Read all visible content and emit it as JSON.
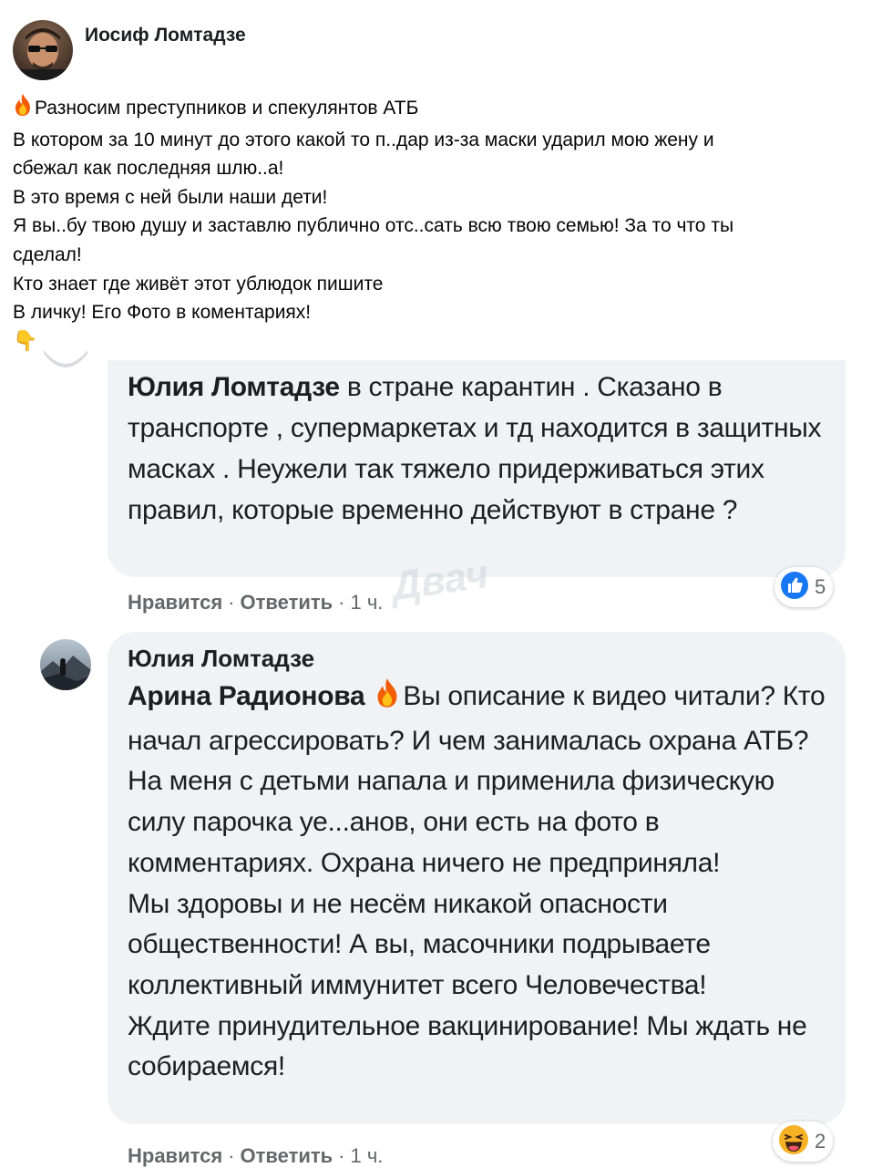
{
  "post": {
    "author": "Иосиф Ломтадзе",
    "lines": [
      "Разносим преступников и спекулянтов АТБ",
      "В котором за 10 минут до этого какой то п..дар из-за маски ударил мою жену и",
      "сбежал как последняя шлю..а!",
      "В это время с ней были наши дети!",
      "Я вы..бу твою душу и заставлю публично отс..сать всю твою семью! За то что ты",
      "сделал!",
      "Кто знает где живёт этот ублюдок пишите",
      "В личку! Его Фото в коментариях!"
    ],
    "leading_emoji": "fire-icon",
    "trailing_emoji": "👇"
  },
  "comments": [
    {
      "mention": "Юлия Ломтадзе",
      "text": " в стране карантин . Сказано в транспорте , супермаркетах и тд находится в защитных масках . Неужели так тяжело придерживаться этих правил, которые временно действуют в стране ?",
      "reaction_icon": "like-icon",
      "reaction_count": "5",
      "like_label": "Нравится",
      "reply_label": "Ответить",
      "time": "1 ч."
    },
    {
      "author": "Юлия Ломтадзе",
      "mention": "Арина Радионова",
      "text": "Вы описание к видео читали? Кто начал агрессировать? И чем занималась охрана АТБ? На меня с детьми напала и применила физическую силу парочка уе...анов, они есть на фото в комментариях. Охрана ничего не предприняла!",
      "text_2": "Мы здоровы и не несём никакой опасности общественности! А вы, масочники подрываете коллективный иммунитет всего Человечества!",
      "text_3": "Ждите принудительное вакцинирование! Мы ждать не собираемся!",
      "reaction_icon": "laughing-icon",
      "reaction_count": "2",
      "like_label": "Нравится",
      "reply_label": "Ответить",
      "time": "1 ч."
    }
  ],
  "watermark": "Двач",
  "colors": {
    "bubble": "#f0f2f5",
    "meta_text": "#65676b",
    "like_blue": "#1877f2",
    "haha_yellow": "#f7b125"
  }
}
